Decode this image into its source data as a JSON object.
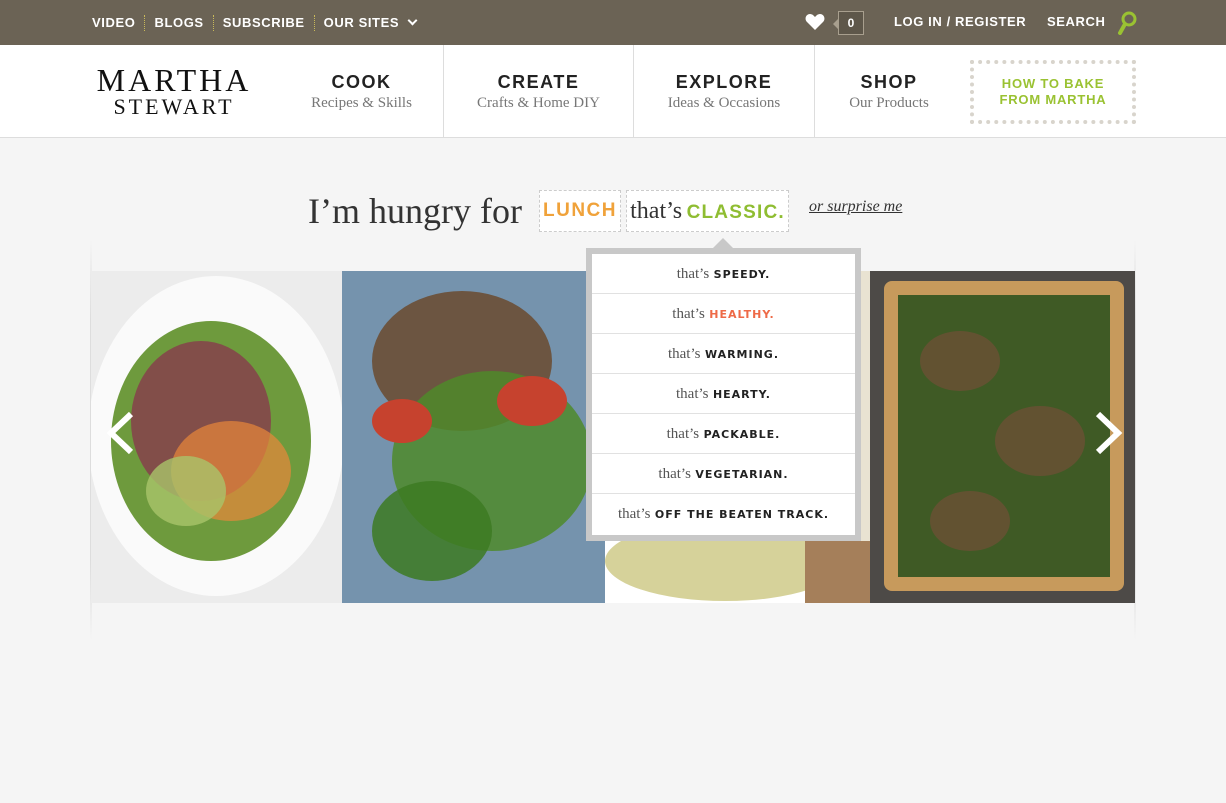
{
  "topbar": {
    "links": [
      "VIDEO",
      "BLOGS",
      "SUBSCRIBE",
      "OUR SITES"
    ],
    "favorites_count": "0",
    "login": "LOG IN / REGISTER",
    "search": "SEARCH"
  },
  "logo": {
    "line1": "MARTHA",
    "line2": "STEWART"
  },
  "nav": [
    {
      "title": "COOK",
      "subtitle": "Recipes & Skills"
    },
    {
      "title": "CREATE",
      "subtitle": "Crafts & Home DIY"
    },
    {
      "title": "EXPLORE",
      "subtitle": "Ideas & Occasions"
    },
    {
      "title": "SHOP",
      "subtitle": "Our Products"
    }
  ],
  "promo": {
    "line1": "HOW TO BAKE",
    "line2": "FROM MARTHA"
  },
  "hungry": {
    "prefix": "I’m hungry for",
    "meal": "LUNCH",
    "thats": "that’s",
    "quality": "CLASSIC.",
    "surprise": "or surprise me"
  },
  "dropdown": {
    "thats": "that’s",
    "options": [
      {
        "word": "SPEEDY.",
        "highlight": false
      },
      {
        "word": "HEALTHY.",
        "highlight": true
      },
      {
        "word": "WARMING.",
        "highlight": false
      },
      {
        "word": "HEARTY.",
        "highlight": false
      },
      {
        "word": "PACKABLE.",
        "highlight": false
      },
      {
        "word": "VEGETARIAN.",
        "highlight": false
      },
      {
        "word": "OFF THE BEATEN TRACK.",
        "highlight": false
      }
    ]
  },
  "colors": {
    "topbar": "#6b6355",
    "accent_green": "#9ac232",
    "meal_orange": "#f0a23a",
    "highlight_red": "#ee6a47"
  },
  "carousel": {
    "icons": [
      "chevron-left-icon",
      "chevron-right-icon"
    ]
  }
}
